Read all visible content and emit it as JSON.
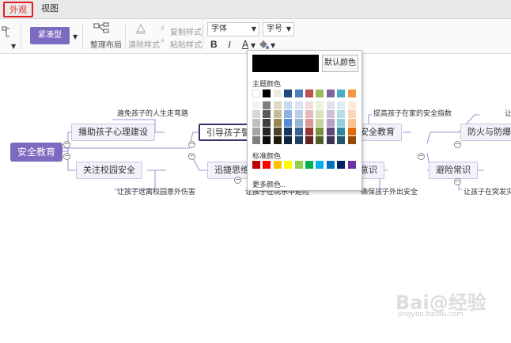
{
  "tabs": {
    "appearance": "外观",
    "view": "视图"
  },
  "ribbon": {
    "style_button": "紧凑型",
    "layout_label": "整理布局",
    "clear_style": "清除样式",
    "copy_style": "复制样式",
    "paste_style": "粘贴样式",
    "font_select": "字体",
    "size_select": "字号",
    "bold": "B",
    "italic": "I",
    "font_color": "A"
  },
  "mindmap": {
    "root": "安全教育",
    "n1": "播助孩子心理建设",
    "n2": "关注校园安全",
    "n3": "引导孩子警",
    "n4": "迅捷思维导",
    "n5": "安全教育",
    "n6": "意识",
    "n7": "防火与防爆",
    "n8": "避险常识",
    "l1": "遍免孩子的人生走弯路",
    "l2": "让孩子远离校园意外伤害",
    "l3": "让孩子在玩乐中避险",
    "l4": "提高孩子在家的安全指数",
    "l5": "确保孩子外出安全",
    "l6": "让孩子在突发灾",
    "l7": "让"
  },
  "color_popup": {
    "default_button": "默认颜色",
    "theme_label": "主题颜色",
    "standard_label": "标准颜色",
    "more_label": "更多颜色..",
    "current_color": "#000000",
    "theme_top": [
      "#ffffff",
      "#000000",
      "#eeece1",
      "#1f497d",
      "#4f81bd",
      "#c0504d",
      "#9bbb59",
      "#8064a2",
      "#4bacc6",
      "#f79646"
    ],
    "theme_shades": [
      [
        "#f2f2f2",
        "#7f7f7f",
        "#ddd9c3",
        "#c6d9f0",
        "#dbe5f1",
        "#f2dcdb",
        "#ebf1dd",
        "#e5e0ec",
        "#dbeef3",
        "#fdeada"
      ],
      [
        "#d8d8d8",
        "#595959",
        "#c4bd97",
        "#8db3e2",
        "#b8cce4",
        "#e5b9b7",
        "#d7e3bc",
        "#ccc1d9",
        "#b7dde8",
        "#fbd5b5"
      ],
      [
        "#bfbfbf",
        "#3f3f3f",
        "#938953",
        "#548dd4",
        "#95b3d7",
        "#d99694",
        "#c3d69b",
        "#b2a2c7",
        "#92cddc",
        "#fac08f"
      ],
      [
        "#a5a5a5",
        "#262626",
        "#494429",
        "#17365d",
        "#366092",
        "#953734",
        "#76923c",
        "#5f497a",
        "#31859b",
        "#e36c09"
      ],
      [
        "#7f7f7f",
        "#0c0c0c",
        "#1d1b10",
        "#0f243e",
        "#244061",
        "#632423",
        "#4f6128",
        "#3f3151",
        "#205867",
        "#974806"
      ]
    ],
    "standard": [
      "#c00000",
      "#ff0000",
      "#ffc000",
      "#ffff00",
      "#92d050",
      "#00b050",
      "#00b0f0",
      "#0070c0",
      "#002060",
      "#7030a0"
    ]
  },
  "watermark": {
    "main": "Bai@经验",
    "sub": "jingyan.baidu.com"
  }
}
